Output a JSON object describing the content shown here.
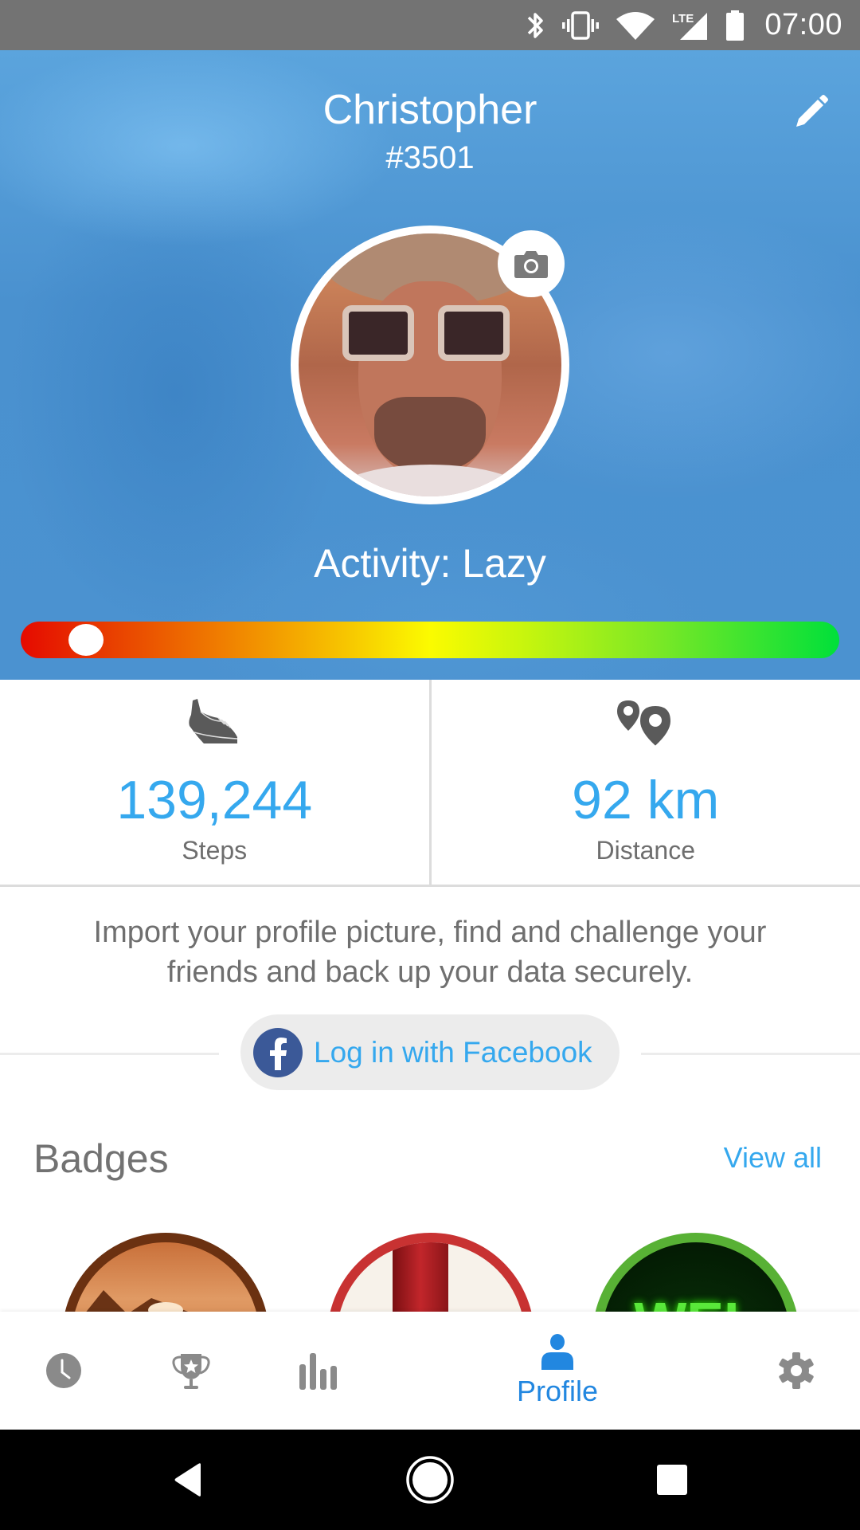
{
  "status_bar": {
    "time": "07:00",
    "icons": [
      "bluetooth-icon",
      "vibrate-icon",
      "wifi-icon",
      "lte-signal-icon",
      "battery-icon"
    ],
    "network_label": "LTE"
  },
  "profile": {
    "name": "Christopher",
    "user_id": "#3501",
    "edit_icon": "pencil-icon",
    "camera_icon": "camera-icon",
    "activity_label": "Activity: Lazy",
    "activity_level_fraction": 0.08
  },
  "stats": [
    {
      "icon": "sneaker-icon",
      "value": "139,244",
      "label": "Steps"
    },
    {
      "icon": "map-pins-icon",
      "value": "92 km",
      "label": "Distance"
    }
  ],
  "promo": {
    "text": "Import your profile picture, find and challenge your friends and back up your data securely.",
    "facebook_button_label": "Log in with Facebook",
    "facebook_glyph": "f"
  },
  "badges": {
    "title": "Badges",
    "view_all_label": "View all",
    "items": [
      {
        "name": "sunset-mountain-badge",
        "border_color": "#6b3111"
      },
      {
        "name": "red-legs-badge",
        "border_color": "#c83232"
      },
      {
        "name": "neon-wel-badge",
        "border_color": "#58b135",
        "visible_text": "WEL"
      }
    ]
  },
  "bottom_nav": {
    "items": [
      {
        "icon": "clock-icon",
        "label": ""
      },
      {
        "icon": "trophy-icon",
        "label": ""
      },
      {
        "icon": "bar-chart-icon",
        "label": ""
      },
      {
        "icon": "person-icon",
        "label": "Profile",
        "active": true
      },
      {
        "icon": "gear-icon",
        "label": ""
      }
    ],
    "active_color": "#2287e0",
    "inactive_color": "#8a8a8a"
  },
  "system_nav": [
    "back-icon",
    "home-icon",
    "recents-icon"
  ],
  "colors": {
    "accent": "#35a8ee",
    "header_blue": "#4a91cf",
    "facebook": "#3b5998"
  }
}
